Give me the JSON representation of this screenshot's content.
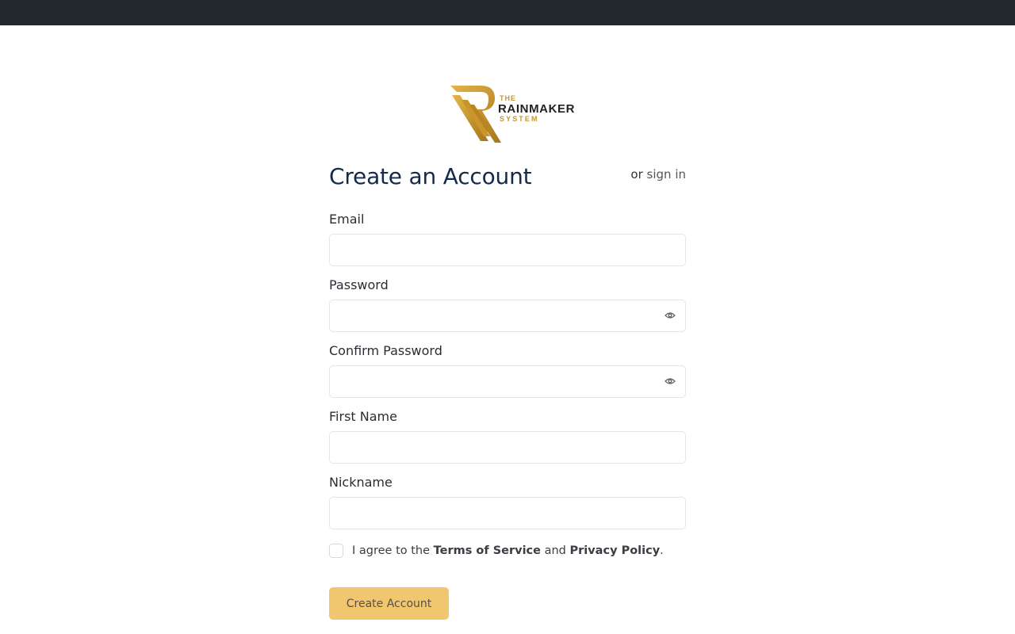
{
  "logo": {
    "the": "THE",
    "name": "RAINMAKER",
    "system": "SYSTEM"
  },
  "page": {
    "title": "Create an Account",
    "signin_prefix": "or",
    "signin_link": "sign in"
  },
  "fields": {
    "email": {
      "label": "Email",
      "value": ""
    },
    "password": {
      "label": "Password",
      "value": ""
    },
    "confirm_password": {
      "label": "Confirm Password",
      "value": ""
    },
    "first_name": {
      "label": "First Name",
      "value": ""
    },
    "nickname": {
      "label": "Nickname",
      "value": ""
    }
  },
  "agreement": {
    "prefix": "I agree to the",
    "terms": "Terms of Service",
    "and": "and",
    "privacy": "Privacy Policy",
    "suffix": ".",
    "checked": false
  },
  "submit": {
    "label": "Create Account"
  },
  "colors": {
    "topbar": "#23282d",
    "title": "#142a4a",
    "accent": "#f0c66f",
    "logo_gold": "#c9962b"
  },
  "icons": {
    "password_toggle": "eye-icon"
  }
}
